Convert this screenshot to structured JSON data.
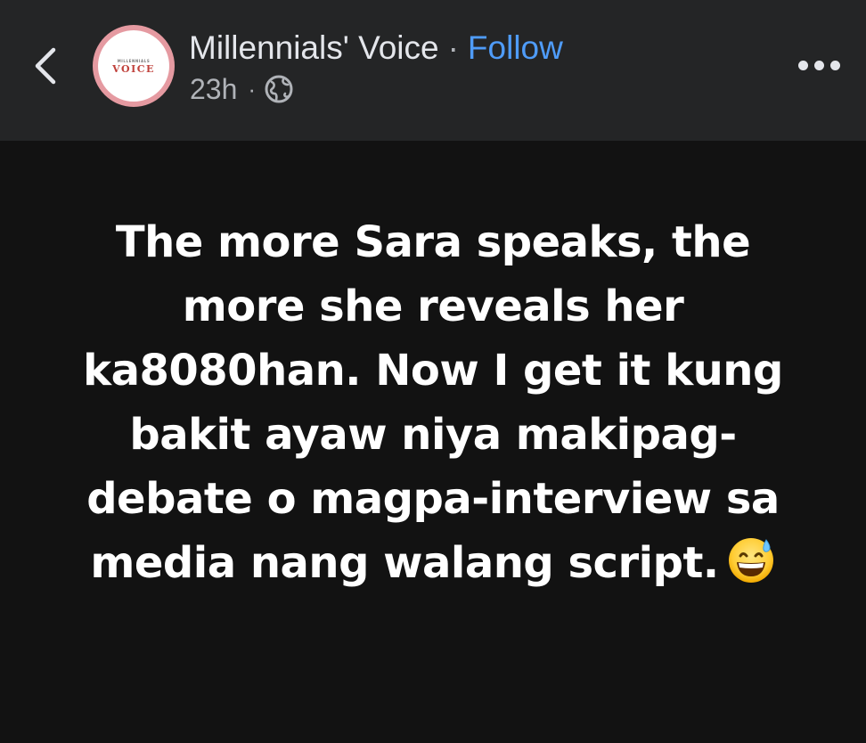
{
  "header": {
    "page_name": "Millennials'  Voice",
    "separator": "·",
    "follow_label": "Follow",
    "timestamp": "23h",
    "meta_separator": "·",
    "privacy_icon": "globe-icon",
    "back_icon": "chevron-left-icon",
    "more_icon": "more-horizontal-icon"
  },
  "avatar": {
    "small_text": "MILLENNIALS",
    "big_text": "VOICE",
    "ring_color": "#e59aa1",
    "text_color": "#c0413b"
  },
  "post": {
    "text": "The more Sara speaks, the more she reveals her ka8080han. Now I get it kung bakit ayaw niya makipag-debate o magpa-interview sa media nang walang script.",
    "emoji": "grinning-face-with-sweat-icon",
    "background_color": "#121212",
    "text_color": "#ffffff"
  },
  "colors": {
    "header_bg": "#242526",
    "follow": "#4f9cf9",
    "secondary_text": "#b0b3b8"
  }
}
